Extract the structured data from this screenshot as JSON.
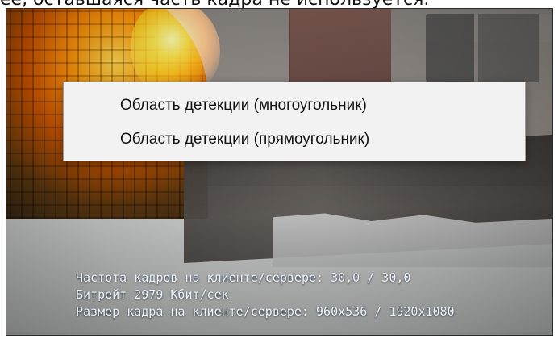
{
  "top_text": "ее, оставшаяся часть кадра не используется.",
  "context_menu": {
    "items": [
      {
        "label": "Область детекции (многоугольник)"
      },
      {
        "label": "Область детекции (прямоугольник)"
      }
    ]
  },
  "overlay_info": {
    "lines": [
      "Частота кадров на клиенте/сервере: 30,0 / 30,0",
      "Битрейт 2979 Кбит/сек",
      "Размер кадра на клиенте/сервере: 960x536 / 1920x1080"
    ]
  }
}
